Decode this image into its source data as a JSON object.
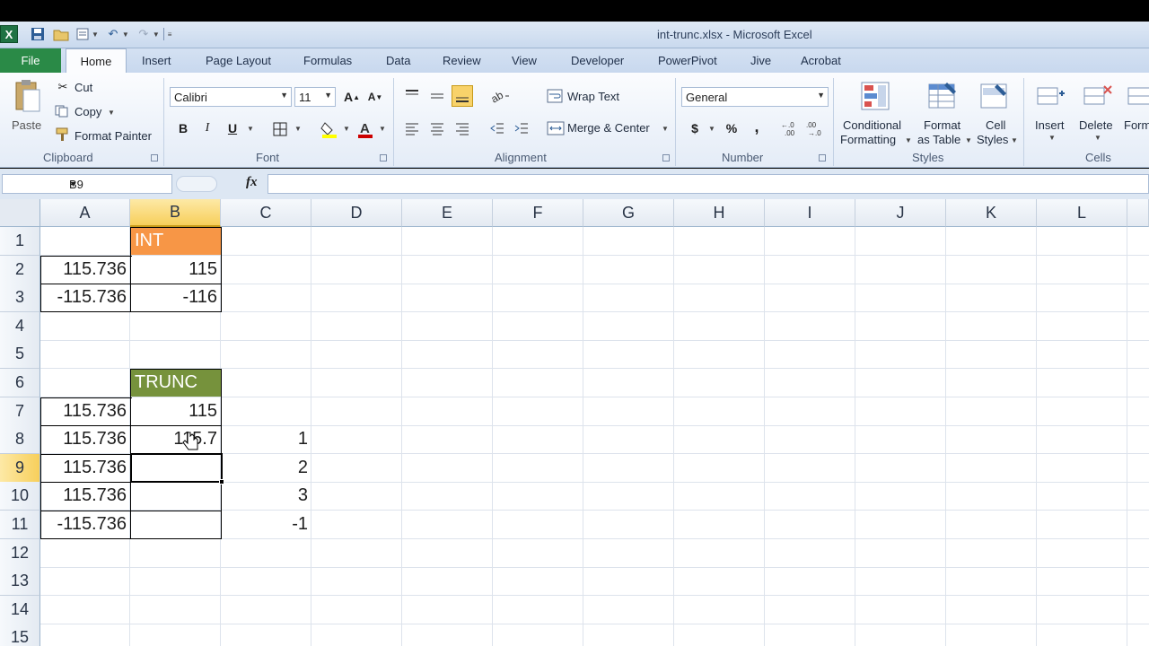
{
  "window": {
    "title": "int-trunc.xlsx  -  Microsoft Excel",
    "app_icon": "X"
  },
  "tabs": [
    {
      "label": "File"
    },
    {
      "label": "Home"
    },
    {
      "label": "Insert"
    },
    {
      "label": "Page Layout"
    },
    {
      "label": "Formulas"
    },
    {
      "label": "Data"
    },
    {
      "label": "Review"
    },
    {
      "label": "View"
    },
    {
      "label": "Developer"
    },
    {
      "label": "PowerPivot"
    },
    {
      "label": "Jive"
    },
    {
      "label": "Acrobat"
    }
  ],
  "ribbon": {
    "clipboard": {
      "paste": "Paste",
      "cut": "Cut",
      "copy": "Copy",
      "format_painter": "Format Painter",
      "label": "Clipboard"
    },
    "font": {
      "name": "Calibri",
      "size": "11",
      "bold": "B",
      "italic": "I",
      "underline": "U",
      "label": "Font",
      "font_color": "#cc0000",
      "fill_color": "#ffff00"
    },
    "alignment": {
      "wrap": "Wrap Text",
      "merge": "Merge & Center",
      "label": "Alignment"
    },
    "number": {
      "format": "General",
      "currency": "$",
      "percent": "%",
      "comma": ",",
      "label": "Number"
    },
    "styles": {
      "cond_1": "Conditional",
      "cond_2": "Formatting",
      "fmt_1": "Format",
      "fmt_2": "as Table",
      "cell_1": "Cell",
      "cell_2": "Styles",
      "label": "Styles"
    },
    "cells": {
      "insert": "Insert",
      "delete": "Delete",
      "format": "Form",
      "label": "Cells"
    }
  },
  "formula_bar": {
    "name_box": "B9",
    "fx": "fx",
    "formula": ""
  },
  "columns": [
    "A",
    "B",
    "C",
    "D",
    "E",
    "F",
    "G",
    "H",
    "I",
    "J",
    "K",
    "L"
  ],
  "rows": [
    "1",
    "2",
    "3",
    "4",
    "5",
    "6",
    "7",
    "8",
    "9",
    "10",
    "11",
    "12",
    "13",
    "14",
    "15"
  ],
  "selected": {
    "column": "B",
    "row": "9"
  },
  "cells": {
    "B1": "INT",
    "A2": "115.736",
    "B2": "115",
    "A3": "-115.736",
    "B3": "-116",
    "B6": "TRUNC",
    "A7": "115.736",
    "B7": "115",
    "A8": "115.736",
    "B8": "115.7",
    "C8": "1",
    "A9": "115.736",
    "C9": "2",
    "A10": "115.736",
    "C10": "3",
    "A11": "-115.736",
    "C11": "-1"
  },
  "colors": {
    "int_header": "#f79646",
    "trunc_header": "#76923c",
    "file_tab": "#2a8a47"
  }
}
